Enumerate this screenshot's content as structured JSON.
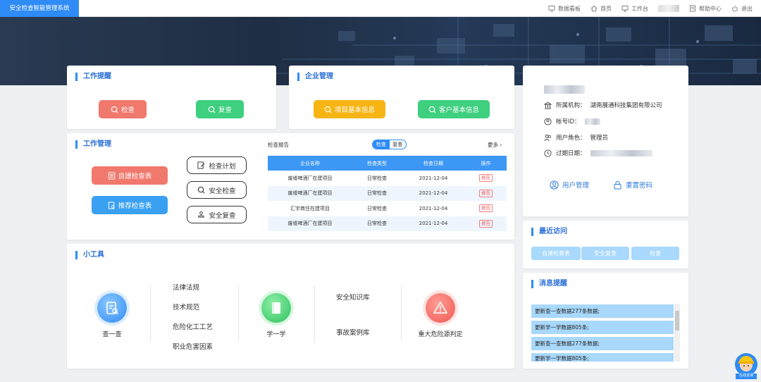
{
  "app": {
    "title": "安全检查智能管理系统"
  },
  "topnav": {
    "dashboard": "数据看板",
    "home": "首页",
    "workbench": "工作台",
    "help": "帮助中心",
    "logout": "退出"
  },
  "work_reminder": {
    "title": "工作提醒",
    "check": "检查",
    "recheck": "复查"
  },
  "enterprise": {
    "title": "企业管理",
    "project_info": "项目基本信息",
    "customer_info": "客户基本信息"
  },
  "work_manage": {
    "title": "工作管理",
    "self_build": "自建检查表",
    "recommend": "推荐检查表",
    "plan": "检查计划",
    "safety_check": "安全检查",
    "safety_recheck": "安全复查"
  },
  "report": {
    "title": "检查报告",
    "toggle": [
      "检查",
      "复查"
    ],
    "more": "更多",
    "columns": [
      "企业名称",
      "检查类型",
      "检查日期",
      "操作"
    ],
    "rows": [
      {
        "name": "废墟啤酒厂在建项目",
        "type": "日常检查",
        "date": "2021-12-04",
        "op": "报告"
      },
      {
        "name": "废墟啤酒厂在建项目",
        "type": "日常检查",
        "date": "2021-12-04",
        "op": "报告"
      },
      {
        "name": "汇宇商住在建项目",
        "type": "日常检查",
        "date": "2021-12-04",
        "op": "报告"
      },
      {
        "name": "废墟啤酒厂在建项目",
        "type": "日常检查",
        "date": "2021-12-04",
        "op": "报告"
      }
    ]
  },
  "tools": {
    "title": "小工具",
    "lookup": "查一查",
    "links1": [
      "法律法规",
      "技术规范",
      "危险化工工艺",
      "职业危害因素"
    ],
    "learn": "学一学",
    "links2": [
      "安全知识库",
      "事故案例库"
    ],
    "hazard": "重大危险源判定"
  },
  "profile": {
    "org_label": "所属机构：",
    "org": "湖南展通科技集团有限公司",
    "account_label": "帐号ID：",
    "role_label": "用户角色：",
    "role": "管理员",
    "expire_label": "过期日期：",
    "user_manage": "用户管理",
    "reset_pwd": "重置密码"
  },
  "recent": {
    "title": "最近访问",
    "items": [
      "自建检查表",
      "安全复查",
      "检查"
    ]
  },
  "messages": {
    "title": "消息提醒",
    "items": [
      "更新查一查数据277条数据;",
      "更新学一学数据805条;",
      "更新查一查数据277条数据;",
      "更新学一学数据805条;"
    ]
  },
  "online_help": "在线咨询"
}
